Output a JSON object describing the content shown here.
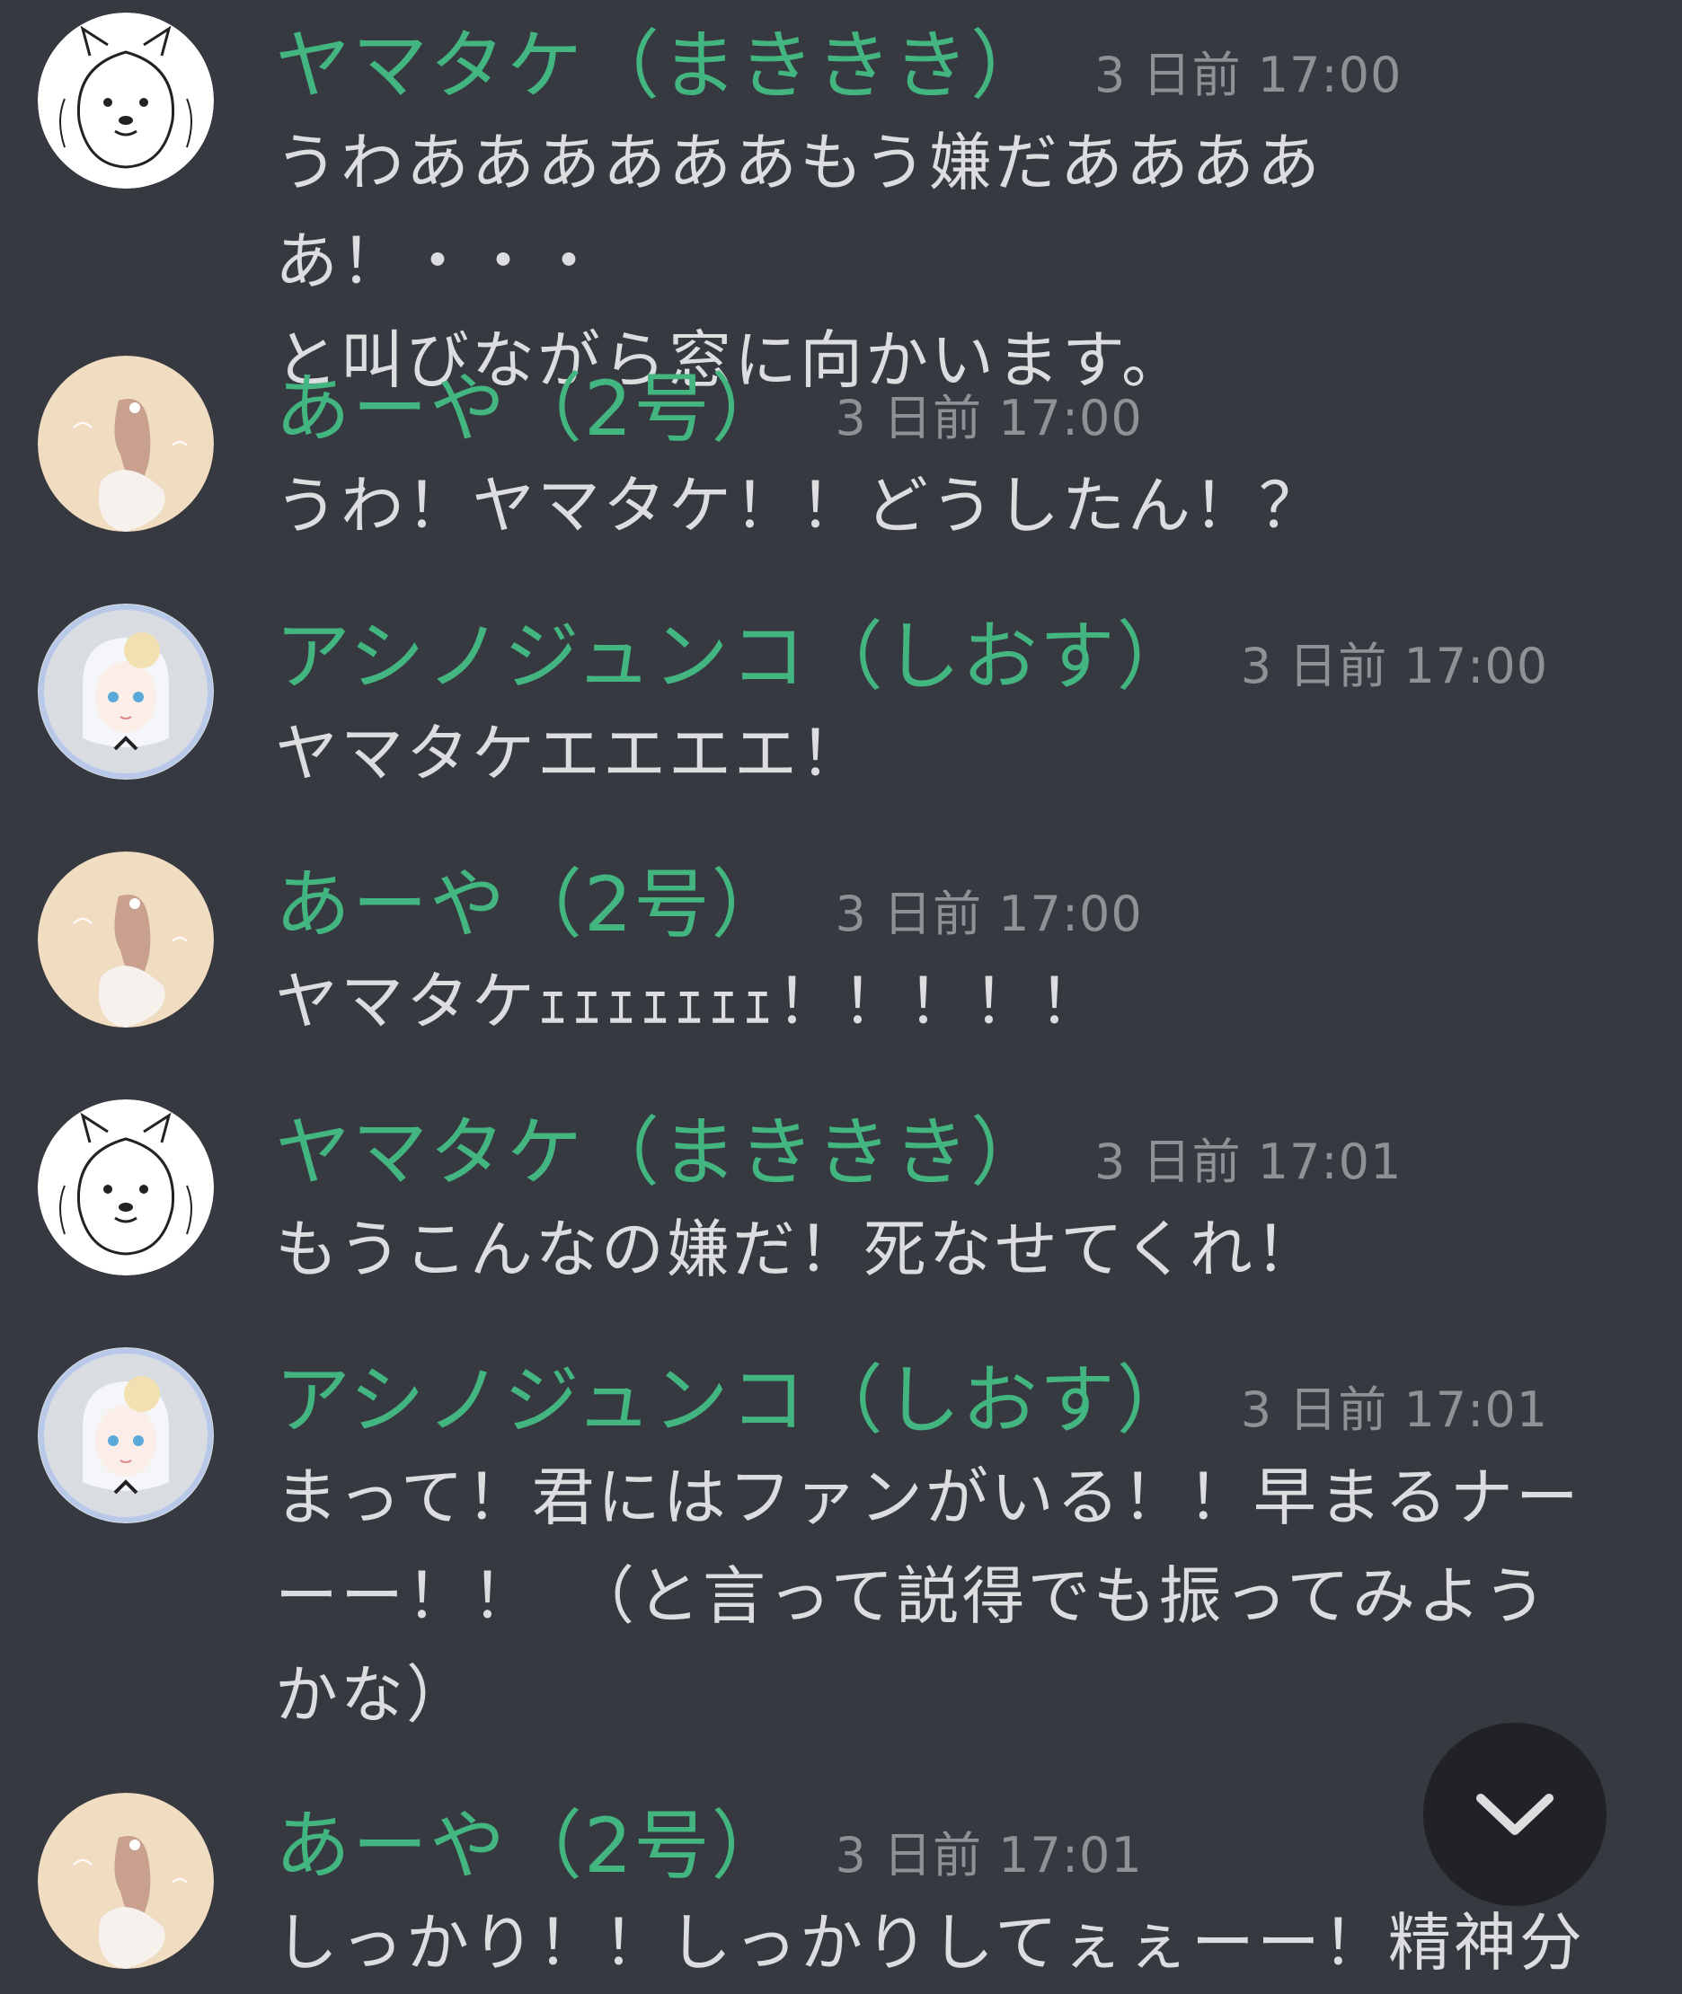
{
  "messages": [
    {
      "avatar": "squirrel-icon",
      "name": "ヤマタケ（まききき）",
      "time": "3 日前 17:00",
      "text": "うわああああああもう嫌だあああああ！・・・\nと叫びながら窓に向かいます。"
    },
    {
      "avatar": "girl-pink-icon",
      "name": "あーや（2号）",
      "time": "3 日前 17:00",
      "text": "うわ！ヤマタケ！！どうしたん！？"
    },
    {
      "avatar": "girl-white-icon",
      "name": "アシノジュンコ（しおす）",
      "time": "3 日前 17:00",
      "text": "ヤマタケエエエエ！"
    },
    {
      "avatar": "girl-pink-icon",
      "name": "あーや（2号）",
      "time": "3 日前 17:00",
      "text": "ヤマタケｪｪｪｪｪｪｪ！！！！！"
    },
    {
      "avatar": "squirrel-icon",
      "name": "ヤマタケ（まききき）",
      "time": "3 日前 17:01",
      "text": "もうこんなの嫌だ！死なせてくれ！"
    },
    {
      "avatar": "girl-white-icon",
      "name": "アシノジュンコ（しおす）",
      "time": "3 日前 17:01",
      "text": "まって！君にはファンがいる！！早まるナー\nーー！！　（と言って説得でも振ってみよう\nかな）"
    },
    {
      "avatar": "girl-pink-icon",
      "name": "あーや（2号）",
      "time": "3 日前 17:01",
      "text": "しっかり！！しっかりしてぇぇーー！精神分"
    }
  ],
  "scroll_button": {
    "icon": "chevron-down-icon"
  },
  "colors": {
    "background": "#36393f",
    "username": "#43b581",
    "timestamp": "#8e9297",
    "message_text": "#dcddde",
    "scroll_button_bg": "#202225"
  }
}
